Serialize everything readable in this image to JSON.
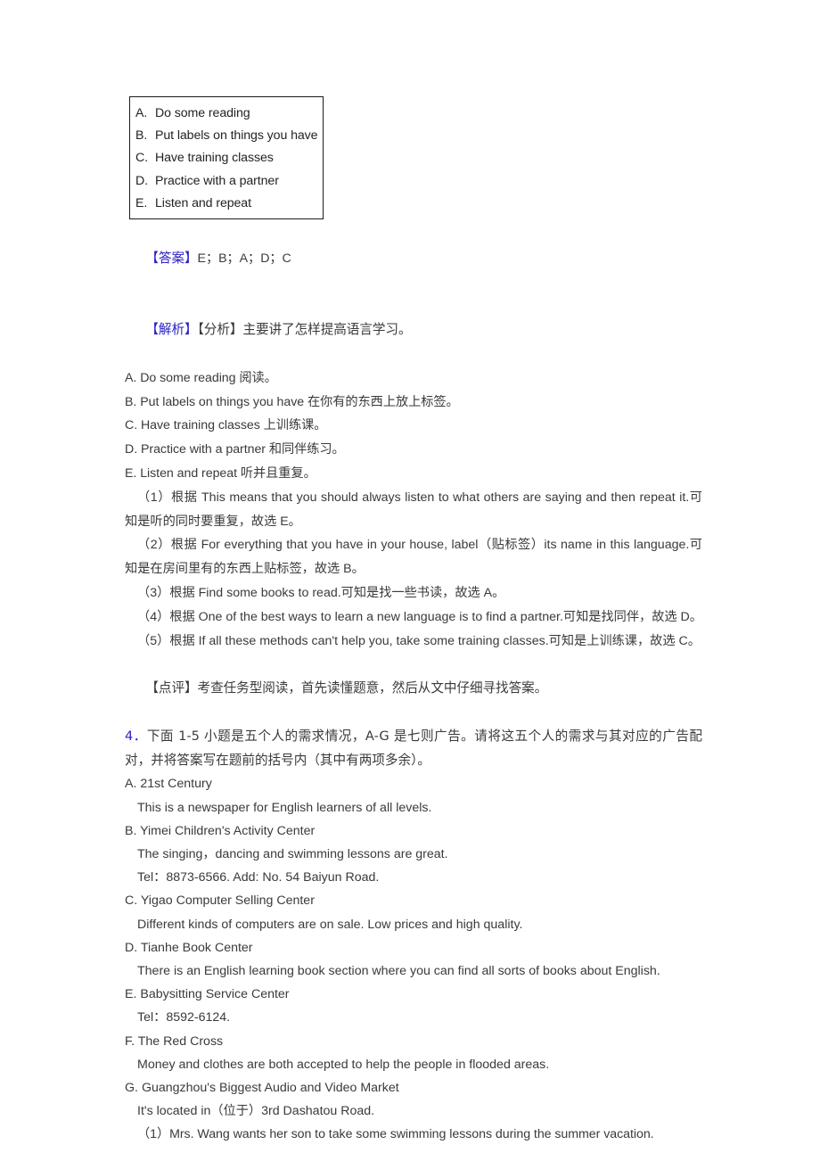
{
  "document": {
    "options_box": {
      "items": [
        {
          "letter": "A.",
          "text": "Do some reading"
        },
        {
          "letter": "B.",
          "text": "Put labels on things you have"
        },
        {
          "letter": "C.",
          "text": "Have training classes"
        },
        {
          "letter": "D.",
          "text": "Practice with a partner"
        },
        {
          "letter": "E.",
          "text": "Listen and repeat"
        }
      ]
    },
    "answer": {
      "label": "【答案】",
      "value": "E；B；A；D；C"
    },
    "analysis": {
      "label": "【解析】",
      "sub_label": "【分析】",
      "summary": "主要讲了怎样提高语言学习。",
      "glossary": [
        "A. Do some reading 阅读。",
        "B. Put labels on things you have 在你有的东西上放上标签。",
        "C. Have training classes 上训练课。",
        "D. Practice with a partner 和同伴练习。",
        "E. Listen and repeat 听并且重复。"
      ],
      "points": [
        "（1）根据 This means that you should always listen to what others are saying and then repeat it.可知是听的同时要重复，故选 E。",
        "（2）根据 For everything that you have in your house, label（贴标签）its name in this language.可知是在房间里有的东西上贴标签，故选 B。",
        "（3）根据 Find some books to read.可知是找一些书读，故选 A。",
        "（4）根据 One of the best ways to learn a new language is to find a partner.可知是找同伴，故选 D。",
        "（5）根据 If all these methods can't help you, take some training classes.可知是上训练课，故选 C。"
      ]
    },
    "comment": {
      "label": "【点评】",
      "text": "考查任务型阅读，首先读懂题意，然后从文中仔细寻找答案。"
    },
    "question4": {
      "number": "4．",
      "stem": "下面 1-5 小题是五个人的需求情况，A-G 是七则广告。请将这五个人的需求与其对应的广告配对，并将答案写在题前的括号内（其中有两项多余）。",
      "ads": [
        {
          "letter": "A.",
          "title": "21st Century",
          "details": [
            "This is a newspaper for English learners of all levels."
          ]
        },
        {
          "letter": "B.",
          "title": "Yimei Children's Activity Center",
          "details": [
            "The singing，dancing and swimming lessons are great.",
            "Tel：8873-6566. Add: No. 54 Baiyun Road."
          ]
        },
        {
          "letter": "C.",
          "title": "Yigao Computer Selling Center",
          "details": [
            "Different kinds of computers are on sale. Low prices and high quality."
          ]
        },
        {
          "letter": "D.",
          "title": "Tianhe Book Center",
          "details": [
            "There is an English learning book section where you can find all sorts of books about English."
          ]
        },
        {
          "letter": "E.",
          "title": "Babysitting Service Center",
          "details": [
            "Tel：8592-6124."
          ]
        },
        {
          "letter": "F.",
          "title": "The Red Cross",
          "details": [
            "Money and clothes are both accepted to help the people in flooded areas."
          ]
        },
        {
          "letter": "G.",
          "title": "Guangzhou's Biggest Audio and Video Market",
          "details": [
            "It's located in（位于）3rd Dashatou Road."
          ]
        }
      ],
      "sub_questions": [
        "（1）Mrs. Wang wants her son to take some swimming lessons during the summer vacation."
      ]
    },
    "colors": {
      "accent_blue": "#2b22c4",
      "body_text": "#3a3a3a",
      "box_border": "#1a1a1a"
    }
  }
}
